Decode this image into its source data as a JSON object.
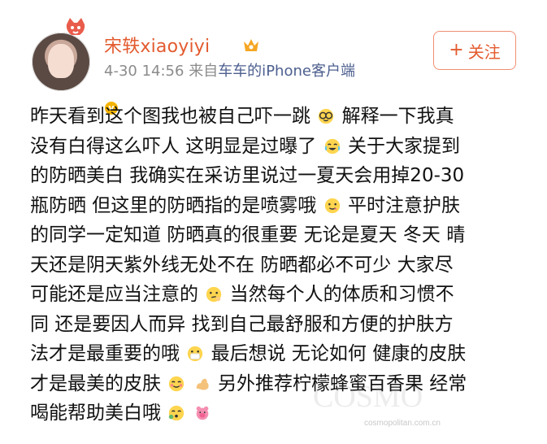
{
  "header": {
    "user_name": "宋轶xiaoyiyi",
    "timestamp": "4-30 14:56",
    "source_prefix": "来自",
    "source_link": "车车的iPhone客户端",
    "follow_button_label": "关注",
    "follow_button_plus": "+"
  },
  "post": {
    "lines": [
      [
        "昨天看到这个图我也被自己吓一跳",
        "[glasses-emoji]",
        "解释一下我真"
      ],
      [
        "没有白得这么吓人 这明显是过曝了",
        "[laugh-cry-emoji]",
        "关于大家提到"
      ],
      [
        "的防晒美白 我确实在采访里说过一夏天会用掉20-30"
      ],
      [
        "瓶防晒 但这里的防晒指的是喷雾哦",
        "[yummy-emoji]",
        "平时注意护肤"
      ],
      [
        "的同学一定知道 防晒真的很重要 无论是夏天 冬天 晴"
      ],
      [
        "天还是阴天紫外线无处不在 防晒都必不可少  大家尽"
      ],
      [
        "可能还是应当注意的",
        "[thinking-emoji]",
        "当然每个人的体质和习惯不"
      ],
      [
        "同 还是要因人而异 找到自己最舒服和方便的护肤方"
      ],
      [
        "法才是最重要的哦",
        "[mask-emoji]",
        "最后想说 无论如何 健康的皮肤"
      ],
      [
        "才是最美的皮肤",
        "[smile-emoji]",
        "[muscle-emoji]",
        "另外推荐柠檬蜂蜜百香果 经常"
      ],
      [
        "喝能帮助美白哦",
        "[kiss-emoji]",
        "[pig-emoji]"
      ]
    ]
  },
  "watermark": {
    "label": "cosmopolitan.com.cn"
  },
  "icons": {
    "avatar_decoration": "fox-badge-icon",
    "vip": "vip-crown-icon",
    "verified": "verified-badge-icon"
  },
  "colors": {
    "name": "#e35b2f",
    "meta": "#8b8b8b",
    "link": "#4d5f8f",
    "button_border": "#f08f72",
    "text": "#111111"
  }
}
